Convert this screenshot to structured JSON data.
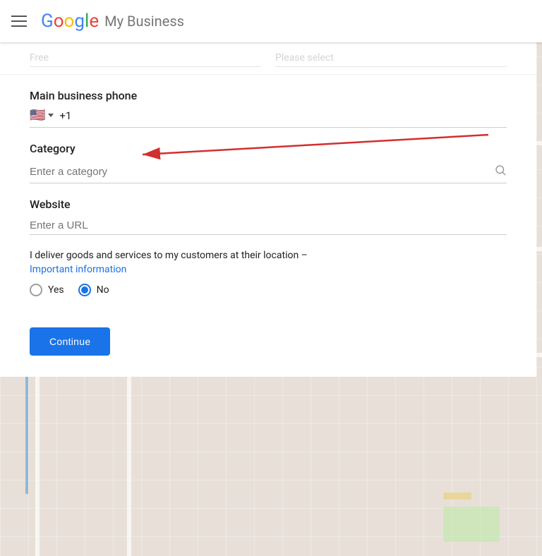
{
  "header": {
    "menu_label": "Menu",
    "google_text": "Google",
    "subtitle": "My Business"
  },
  "top_fields": {
    "field1_placeholder": "Free",
    "field2_placeholder": "Please select"
  },
  "phone": {
    "section_label": "Main business phone",
    "flag": "🇺🇸",
    "country_code": "+1",
    "flag_alt": "US flag"
  },
  "category": {
    "section_label": "Category",
    "input_placeholder": "Enter a category"
  },
  "website": {
    "section_label": "Website",
    "input_placeholder": "Enter a URL"
  },
  "delivery": {
    "text": "I deliver goods and services to my customers at their location –",
    "link_text": "Important information",
    "options": [
      {
        "value": "yes",
        "label": "Yes",
        "selected": false
      },
      {
        "value": "no",
        "label": "No",
        "selected": true
      }
    ]
  },
  "actions": {
    "continue_label": "Continue"
  },
  "colors": {
    "accent_blue": "#1a73e8",
    "arrow_red": "#d32f2f",
    "text_primary": "#212121",
    "text_hint": "#9e9e9e"
  }
}
